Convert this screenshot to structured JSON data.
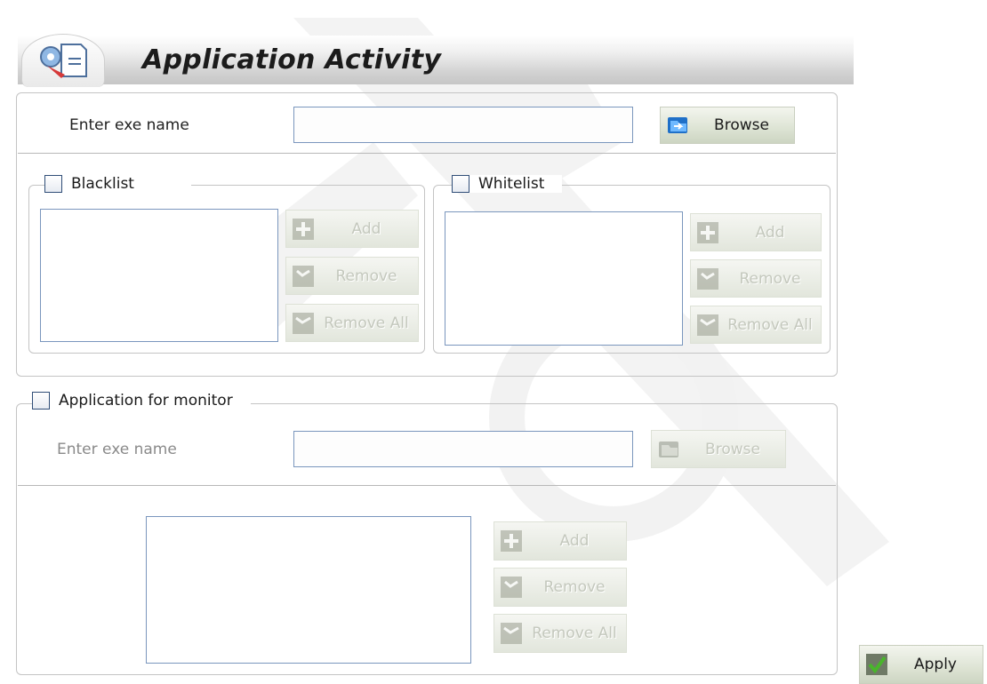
{
  "window": {
    "title": "Application Activity"
  },
  "top_section": {
    "exe_label": "Enter exe name",
    "exe_value": "",
    "browse_label": "Browse"
  },
  "blacklist": {
    "label": "Blacklist",
    "checked": false,
    "add_label": "Add",
    "remove_label": "Remove",
    "remove_all_label": "Remove All"
  },
  "whitelist": {
    "label": "Whitelist",
    "checked": false,
    "add_label": "Add",
    "remove_label": "Remove",
    "remove_all_label": "Remove All"
  },
  "monitor": {
    "label": "Application for monitor",
    "checked": false,
    "exe_label": "Enter exe name",
    "exe_value": "",
    "browse_label": "Browse",
    "add_label": "Add",
    "remove_label": "Remove",
    "remove_all_label": "Remove All"
  },
  "footer": {
    "apply_label": "Apply"
  },
  "icons": {
    "header": "settings-document-icon",
    "browse": "open-folder-icon",
    "add": "plus-icon",
    "remove": "remove-icon",
    "remove_all": "remove-all-icon",
    "apply": "checkmark-icon"
  },
  "colors": {
    "field_border": "#7a96bd",
    "checkbox_border": "#2f4d77",
    "disabled_text": "#c4c8bd",
    "apply_check": "#49b52b"
  }
}
